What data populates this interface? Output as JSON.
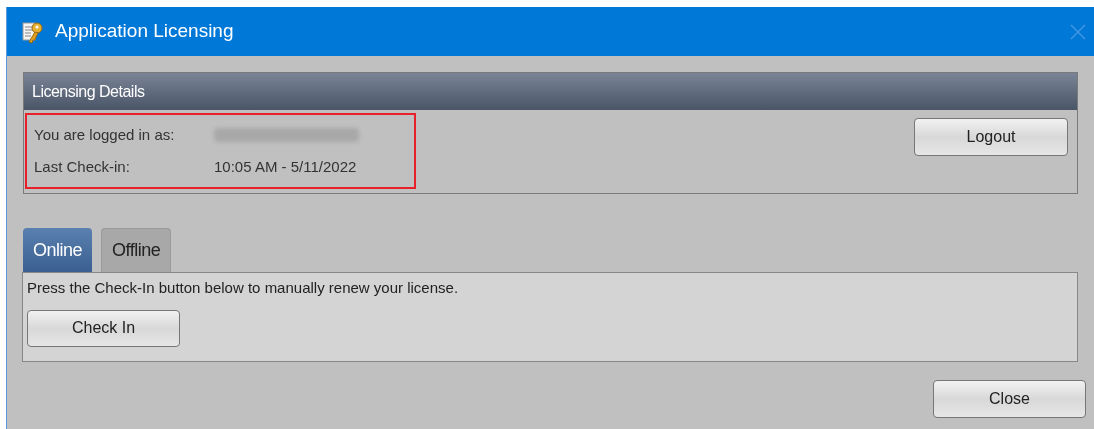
{
  "window": {
    "title": "Application Licensing"
  },
  "licensing_details": {
    "title": "Licensing Details",
    "highlighted": true,
    "fields": [
      {
        "label": "You are logged in as:",
        "value_redacted": true
      },
      {
        "label": "Last Check-in:",
        "value": "10:05 AM - 5/11/2022"
      }
    ],
    "logout_button": "Logout"
  },
  "tabs": [
    {
      "label": "Online",
      "selected": true
    },
    {
      "label": "Offline",
      "selected": false
    }
  ],
  "tab_content": {
    "text": "Press the Check-In button below to manually renew your license.",
    "button": "Check In"
  },
  "buttons": [
    "Close"
  ]
}
